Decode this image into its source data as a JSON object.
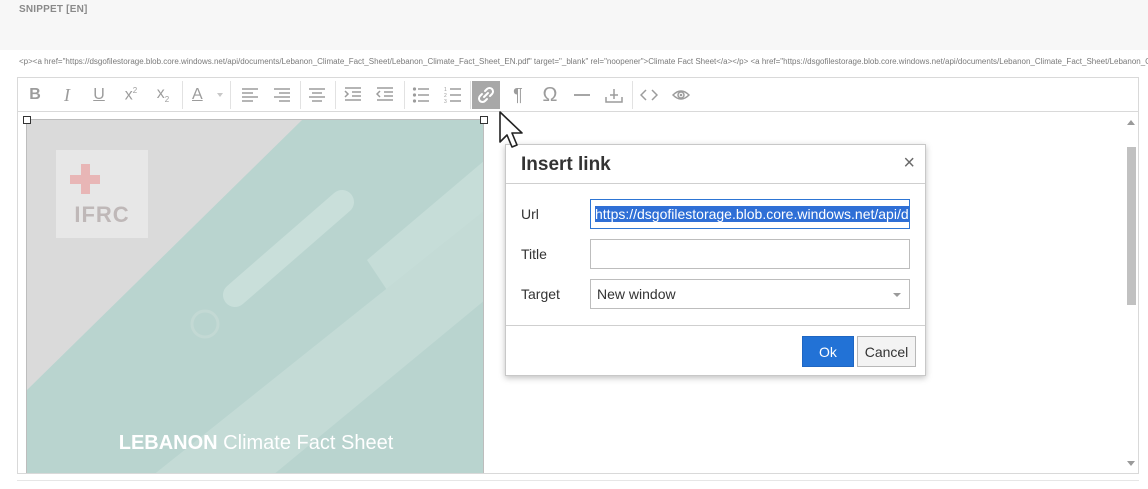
{
  "snippet": {
    "label": "SNIPPET [EN]",
    "source": "<p><a href=\"https://dsgofilestorage.blob.core.windows.net/api/documents/Lebanon_Climate_Fact_Sheet/Lebanon_Climate_Fact_Sheet_EN.pdf\" target=\"_blank\" rel=\"noopener\">Climate Fact Sheet</a></p> <a href=\"https://dsgofilestorage.blob.core.windows.net/api/documents/Lebanon_Climate_Fact_Sheet/Lebanon_Climate_Fact_Sheet_EN.pdf\""
  },
  "toolbar": {
    "bold": "B",
    "italic": "I",
    "underline": "U",
    "superscript": "x",
    "superscript_mark": "2",
    "subscript": "x",
    "subscript_mark": "2",
    "font_color": "A",
    "paragraph": "¶",
    "special_char": "Ω"
  },
  "image": {
    "logo_text": "IFRC",
    "title_bold": "LEBANON",
    "title_rest": " Climate Fact Sheet",
    "colors": {
      "teal": "#b9d4cf",
      "gray": "#dadada",
      "red": "#e8b6b6"
    }
  },
  "dialog": {
    "title": "Insert link",
    "close": "×",
    "url_label": "Url",
    "url_value": "https://dsgofilestorage.blob.core.windows.net/api/documents/Lebanon_Climate_Fact_Sheet/Lebanon_Climate_Fact_Sheet_EN.pdf",
    "title_label": "Title",
    "title_value": "",
    "target_label": "Target",
    "target_value": "New window",
    "ok_label": "Ok",
    "cancel_label": "Cancel",
    "accent": "#2272d6"
  }
}
